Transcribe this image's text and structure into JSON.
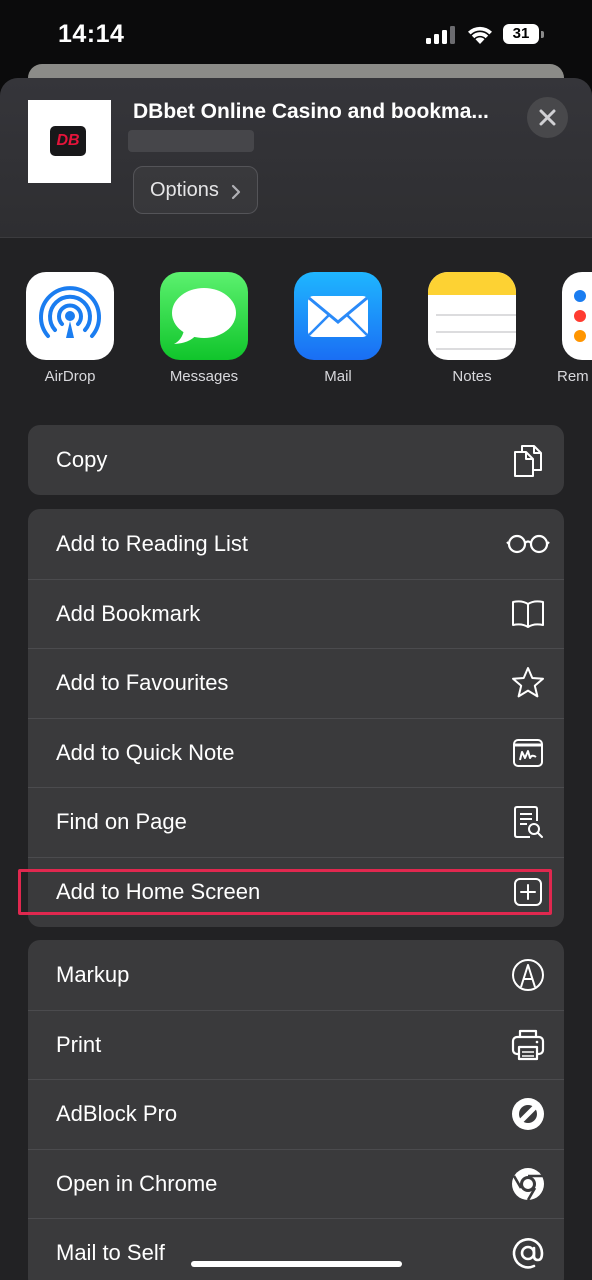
{
  "status_bar": {
    "time": "14:14",
    "battery": "31"
  },
  "header": {
    "site_logo_text": "DB",
    "site_title": "DBbet Online Casino and bookma...",
    "options_label": "Options",
    "brand_color": "#e5143a"
  },
  "apps": [
    {
      "label": "AirDrop",
      "icon": "airdrop-icon"
    },
    {
      "label": "Messages",
      "icon": "messages-icon"
    },
    {
      "label": "Mail",
      "icon": "mail-icon"
    },
    {
      "label": "Notes",
      "icon": "notes-icon"
    },
    {
      "label": "Rem",
      "icon": "reminders-icon"
    }
  ],
  "actions_group_1": [
    {
      "label": "Copy",
      "icon": "copy-icon"
    }
  ],
  "actions_group_2": [
    {
      "label": "Add to Reading List",
      "icon": "glasses-icon"
    },
    {
      "label": "Add Bookmark",
      "icon": "book-icon"
    },
    {
      "label": "Add to Favourites",
      "icon": "star-icon"
    },
    {
      "label": "Add to Quick Note",
      "icon": "quick-note-icon"
    },
    {
      "label": "Find on Page",
      "icon": "find-on-page-icon"
    },
    {
      "label": "Add to Home Screen",
      "icon": "plus-square-icon",
      "highlighted": true
    }
  ],
  "actions_group_3": [
    {
      "label": "Markup",
      "icon": "markup-icon"
    },
    {
      "label": "Print",
      "icon": "printer-icon"
    },
    {
      "label": "AdBlock Pro",
      "icon": "adblock-icon"
    },
    {
      "label": "Open in Chrome",
      "icon": "chrome-icon"
    },
    {
      "label": "Mail to Self",
      "icon": "at-icon"
    }
  ],
  "colors": {
    "sheet_bg": "#222224",
    "row_bg": "#3a3a3c",
    "highlight": "#e0284f"
  }
}
